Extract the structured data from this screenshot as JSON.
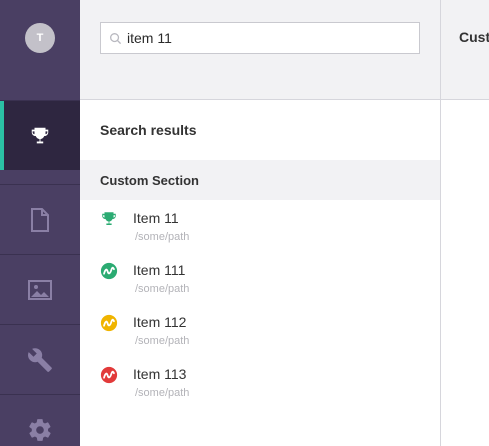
{
  "user": {
    "avatar_initial": "T"
  },
  "sidebar": {
    "items": [
      {
        "icon": "trophy-icon",
        "active": true
      },
      {
        "icon": "document-icon",
        "active": false
      },
      {
        "icon": "image-icon",
        "active": false
      },
      {
        "icon": "wrench-icon",
        "active": false
      },
      {
        "icon": "gear-icon",
        "active": false
      }
    ]
  },
  "search": {
    "value": "item 11",
    "placeholder": ""
  },
  "results": {
    "title": "Search results",
    "section": "Custom Section",
    "items": [
      {
        "name": "Item 11",
        "path": "/some/path",
        "icon": "trophy-icon",
        "color": "#2bab72"
      },
      {
        "name": "Item 111",
        "path": "/some/path",
        "icon": "wave-badge-icon",
        "color": "#2bab72"
      },
      {
        "name": "Item 112",
        "path": "/some/path",
        "icon": "wave-badge-icon",
        "color": "#f0b400"
      },
      {
        "name": "Item 113",
        "path": "/some/path",
        "icon": "wave-badge-icon",
        "color": "#e23a3a"
      }
    ]
  },
  "right_panel": {
    "title": "Custom"
  },
  "colors": {
    "sidebar": "#4a3f63",
    "accent": "#2bc0a4"
  }
}
